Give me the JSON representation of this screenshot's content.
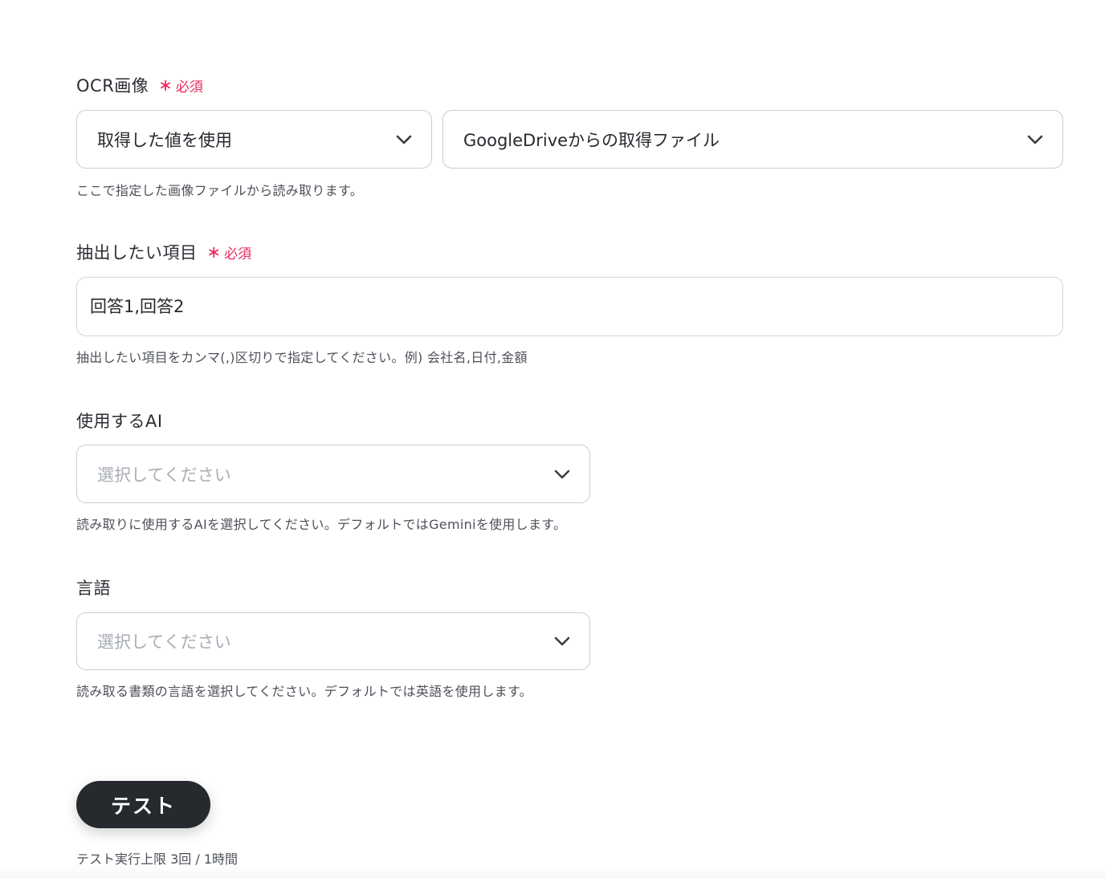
{
  "ocr_image": {
    "label": "OCR画像",
    "required_label": "必須",
    "source_select": {
      "value": "取得した値を使用"
    },
    "file_select": {
      "value": "GoogleDriveからの取得ファイル"
    },
    "help": "ここで指定した画像ファイルから読み取ります。"
  },
  "extract_items": {
    "label": "抽出したい項目",
    "required_label": "必須",
    "value": "回答1,回答2",
    "help": "抽出したい項目をカンマ(,)区切りで指定してください。例) 会社名,日付,金額"
  },
  "ai_select": {
    "label": "使用するAI",
    "placeholder": "選択してください",
    "help": "読み取りに使用するAIを選択してください。デフォルトではGeminiを使用します。"
  },
  "language_select": {
    "label": "言語",
    "placeholder": "選択してください",
    "help": "読み取る書類の言語を選択してください。デフォルトでは英語を使用します。"
  },
  "test": {
    "button_label": "テスト",
    "limit_text": "テスト実行上限 3回 / 1時間"
  },
  "colors": {
    "required": "#e8295b",
    "button_bg": "#26292e",
    "border": "#c9ccd1",
    "placeholder": "#a9aeb6"
  },
  "icons": {
    "select_chevron": "chevron-down-icon",
    "required_marker": "asterisk-icon"
  }
}
